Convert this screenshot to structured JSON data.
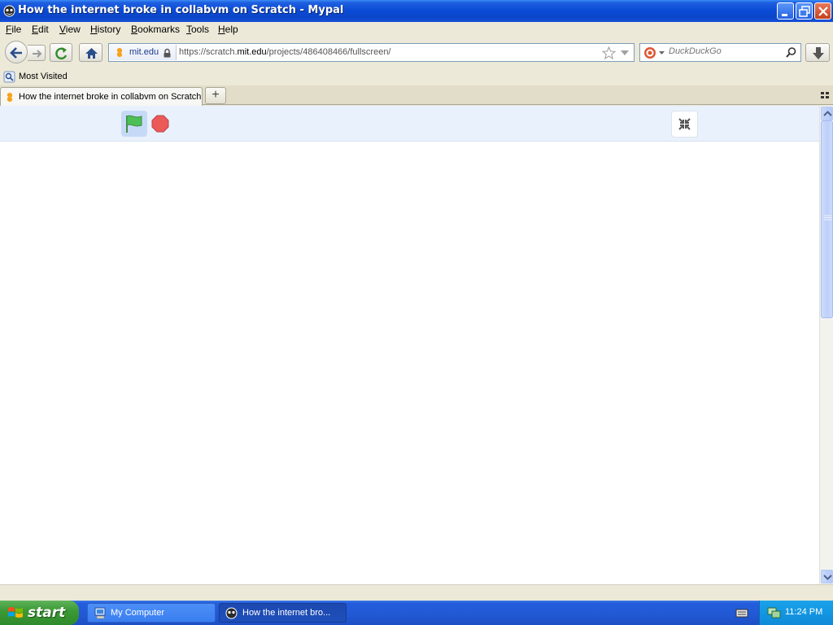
{
  "window": {
    "title": "How the internet broke in collabvm on Scratch - Mypal"
  },
  "menu": {
    "items": [
      {
        "label": "File",
        "accel": "F",
        "rest": "ile"
      },
      {
        "label": "Edit",
        "accel": "E",
        "rest": "dit"
      },
      {
        "label": "View",
        "accel": "V",
        "rest": "iew"
      },
      {
        "label": "History",
        "accel": "H",
        "rest": "istory"
      },
      {
        "label": "Bookmarks",
        "accel": "B",
        "rest": "ookmarks"
      },
      {
        "label": "Tools",
        "accel": "T",
        "rest": "ools"
      },
      {
        "label": "Help",
        "accel": "H",
        "rest": "elp"
      }
    ]
  },
  "navbar": {
    "site_identity": "mit.edu",
    "url_prefix": "https://scratch.",
    "url_domain": "mit.edu",
    "url_suffix": "/projects/486408466/fullscreen/",
    "search_placeholder": "DuckDuckGo"
  },
  "bookmarks": {
    "most_visited": "Most Visited"
  },
  "tabs": {
    "active_label": "How the internet broke in collabvm on Scratch",
    "new_tab_glyph": "+"
  },
  "taskbar": {
    "start_label": "start",
    "tasks": [
      {
        "label": "My Computer"
      },
      {
        "label": "How the internet bro..."
      }
    ],
    "clock": "11:24 PM"
  },
  "colors": {
    "titlebar": "#0a4ad4",
    "controls_bg": "#e9f1fc",
    "green_flag": "#4cbf56",
    "stop": "#ec5959",
    "taskbar": "#245edc",
    "start": "#3c9a36"
  },
  "icons": {
    "app": "mypal-icon",
    "back": "arrow-left-icon",
    "forward": "arrow-right-icon",
    "reload": "reload-icon",
    "home": "home-icon",
    "lock": "lock-icon",
    "star": "star-icon",
    "search": "magnifier-icon",
    "download": "download-arrow-icon",
    "flag": "green-flag-icon",
    "stop": "stop-octagon-icon",
    "unfullscreen": "unfullscreen-icon"
  }
}
